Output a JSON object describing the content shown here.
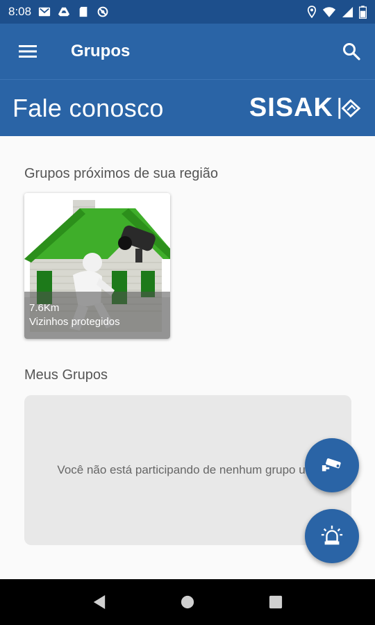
{
  "status_bar": {
    "time": "8:08",
    "left_icons": [
      "gmail-icon",
      "drive-icon",
      "sd-card-icon",
      "blocked-icon"
    ],
    "right_icons": [
      "location-icon",
      "wifi-icon",
      "signal-icon",
      "battery-icon"
    ]
  },
  "app_bar": {
    "title": "Grupos",
    "menu_icon": "hamburger-menu-icon",
    "search_icon": "search-icon"
  },
  "banner": {
    "text": "Fale conosco",
    "brand": "SISAK"
  },
  "nearby": {
    "title": "Grupos próximos de sua região",
    "groups": [
      {
        "distance": "7.6Km",
        "label": "Vizinhos protegidos"
      }
    ]
  },
  "my_groups": {
    "title": "Meus Grupos",
    "empty_message": "Você não está participando de nenhum grupo um!"
  },
  "fabs": [
    {
      "icon": "security-camera-icon"
    },
    {
      "icon": "siren-alarm-icon"
    }
  ],
  "colors": {
    "primary": "#2a64a6",
    "primary_dark": "#1d4f8c",
    "background": "#fafafa",
    "empty_box": "#e8e8e8"
  },
  "nav_bar": {
    "icons": [
      "back-icon",
      "home-icon",
      "recents-icon"
    ]
  }
}
